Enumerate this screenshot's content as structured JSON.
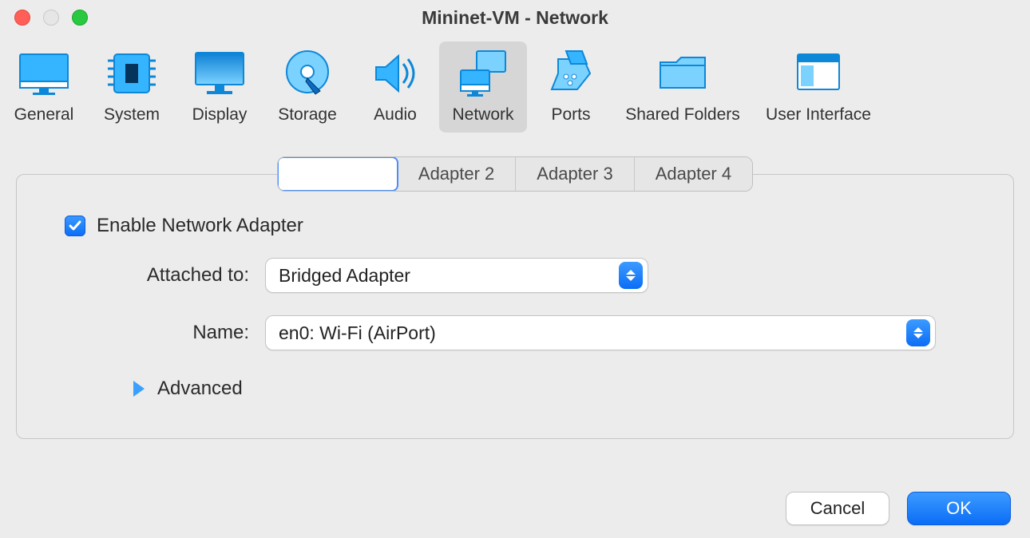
{
  "window": {
    "title": "Mininet-VM - Network"
  },
  "toolbar": {
    "items": [
      {
        "id": "general",
        "label": "General",
        "icon": "monitor-icon",
        "selected": false
      },
      {
        "id": "system",
        "label": "System",
        "icon": "chip-icon",
        "selected": false
      },
      {
        "id": "display",
        "label": "Display",
        "icon": "display-icon",
        "selected": false
      },
      {
        "id": "storage",
        "label": "Storage",
        "icon": "disk-icon",
        "selected": false
      },
      {
        "id": "audio",
        "label": "Audio",
        "icon": "speaker-icon",
        "selected": false
      },
      {
        "id": "network",
        "label": "Network",
        "icon": "network-icon",
        "selected": true
      },
      {
        "id": "ports",
        "label": "Ports",
        "icon": "port-icon",
        "selected": false
      },
      {
        "id": "shared",
        "label": "Shared Folders",
        "icon": "folder-icon",
        "selected": false
      },
      {
        "id": "ui",
        "label": "User Interface",
        "icon": "window-icon",
        "selected": false
      }
    ]
  },
  "tabs": {
    "items": [
      {
        "label": "",
        "active": true
      },
      {
        "label": "Adapter 2",
        "active": false
      },
      {
        "label": "Adapter 3",
        "active": false
      },
      {
        "label": "Adapter 4",
        "active": false
      }
    ]
  },
  "form": {
    "enable_label": "Enable Network Adapter",
    "enable_checked": true,
    "attached_label": "Attached to:",
    "attached_value": "Bridged Adapter",
    "name_label": "Name:",
    "name_value": "en0: Wi-Fi (AirPort)",
    "advanced_label": "Advanced"
  },
  "buttons": {
    "cancel": "Cancel",
    "ok": "OK"
  },
  "colors": {
    "accent": "#0b6df6",
    "background": "#ececec"
  }
}
